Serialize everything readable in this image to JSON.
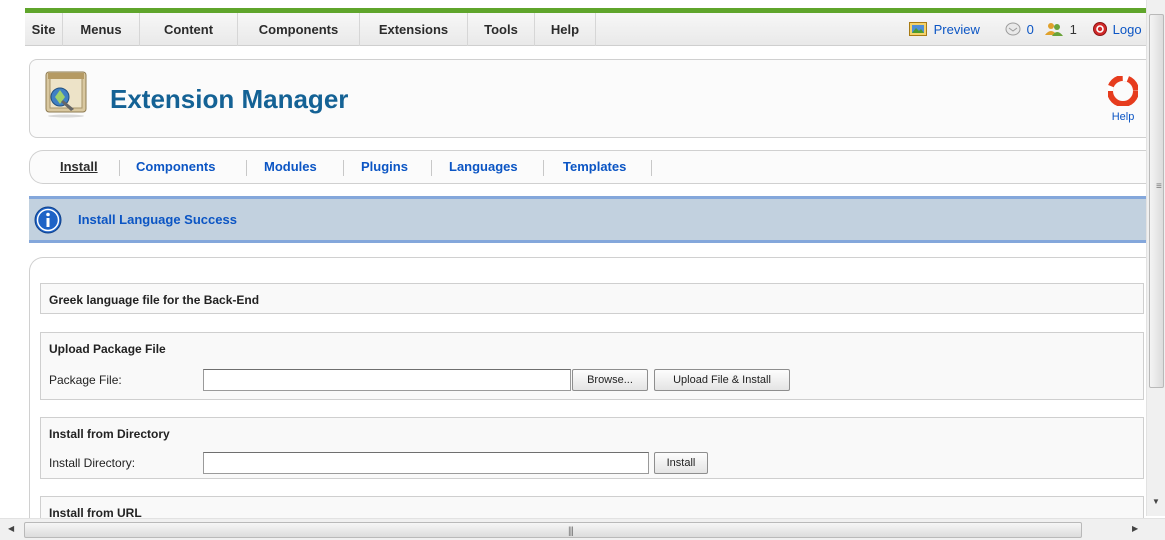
{
  "menubar": {
    "items": [
      "Site",
      "Menus",
      "Content",
      "Components",
      "Extensions",
      "Tools",
      "Help"
    ],
    "preview_label": "Preview",
    "messages_count": "0",
    "users_count": "1",
    "logout_label": "Logo"
  },
  "header": {
    "title": "Extension Manager",
    "help_label": "Help"
  },
  "submenu": {
    "items": [
      "Install",
      "Components",
      "Modules",
      "Plugins",
      "Languages",
      "Templates"
    ],
    "active": "Install"
  },
  "message": {
    "text": "Install Language Success"
  },
  "sections": {
    "language_info": {
      "title": "Greek language file for the Back-End"
    },
    "upload": {
      "title": "Upload Package File",
      "label": "Package File:",
      "value": "",
      "browse_label": "Browse...",
      "submit_label": "Upload File & Install"
    },
    "directory": {
      "title": "Install from Directory",
      "label": "Install Directory:",
      "value": "",
      "submit_label": "Install"
    },
    "url": {
      "title": "Install from URL"
    }
  },
  "colors": {
    "accent_green": "#5fa52b",
    "link_blue": "#0b55c4",
    "title_blue": "#146295",
    "message_bg": "#c2d1df"
  },
  "icons": {
    "preview": "preview-icon",
    "messages": "messages-icon",
    "users": "users-icon",
    "logout": "logout-icon",
    "header": "extension-manager-icon",
    "help": "help-lifebuoy-icon",
    "info": "info-icon"
  }
}
